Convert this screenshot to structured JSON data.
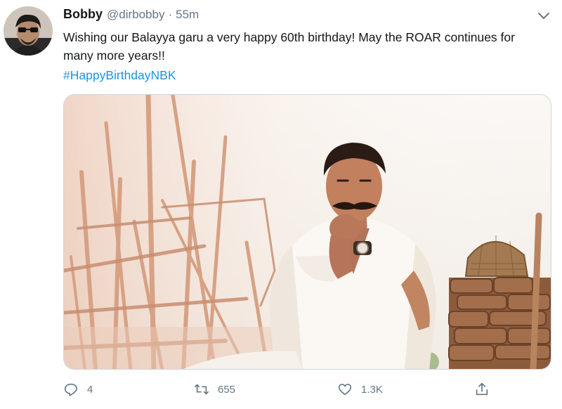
{
  "tweet": {
    "author_name": "Bobby",
    "author_handle": "@dirbobby",
    "separator": "·",
    "time": "55m",
    "text": "Wishing our Balayya garu a very happy 60th birthday! May the ROAR continues for many more years!!",
    "hashtag": "#HappyBirthdayNBK"
  },
  "actions": {
    "replies": "4",
    "retweets": "655",
    "likes": "1.3K"
  },
  "icons": {
    "reply": "reply-icon",
    "retweet": "retweet-icon",
    "like": "heart-icon",
    "share": "share-icon",
    "menu": "chevron-down-icon"
  },
  "colors": {
    "text": "#14171a",
    "muted": "#657786",
    "link": "#1b95e0",
    "border": "#ccd6dd"
  }
}
